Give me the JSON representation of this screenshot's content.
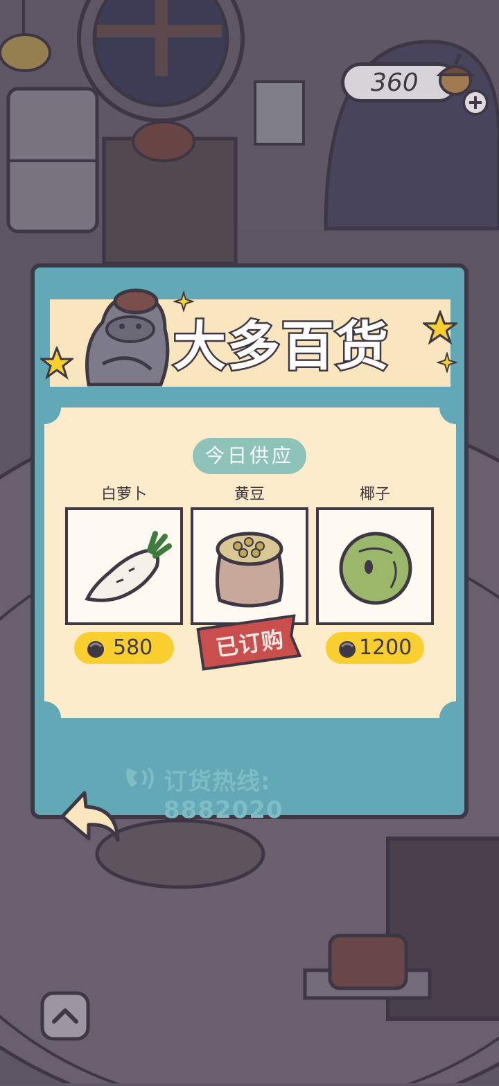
{
  "hud": {
    "currency_amount": "360",
    "plus_icon": "plus-icon",
    "acorn_icon": "acorn-icon"
  },
  "shop": {
    "title": "大多百货",
    "supply_label": "今日供应",
    "items": [
      {
        "name": "白萝卜",
        "icon": "radish-icon",
        "price": "580",
        "status": "available"
      },
      {
        "name": "黄豆",
        "icon": "soybean-sack-icon",
        "status": "ordered",
        "status_label": "已订购"
      },
      {
        "name": "椰子",
        "icon": "coconut-icon",
        "price": "1200",
        "status": "available"
      }
    ],
    "hotline": "订货热线: 8882020"
  },
  "controls": {
    "back_icon": "back-arrow-icon",
    "expand_icon": "chevron-up-icon"
  },
  "colors": {
    "panel": "#62a8b6",
    "banner": "#f9e6bf",
    "card": "#fdeccb",
    "price_pill": "#f8cf2f",
    "stamp": "#c94f4f",
    "outline": "#3e3744"
  }
}
